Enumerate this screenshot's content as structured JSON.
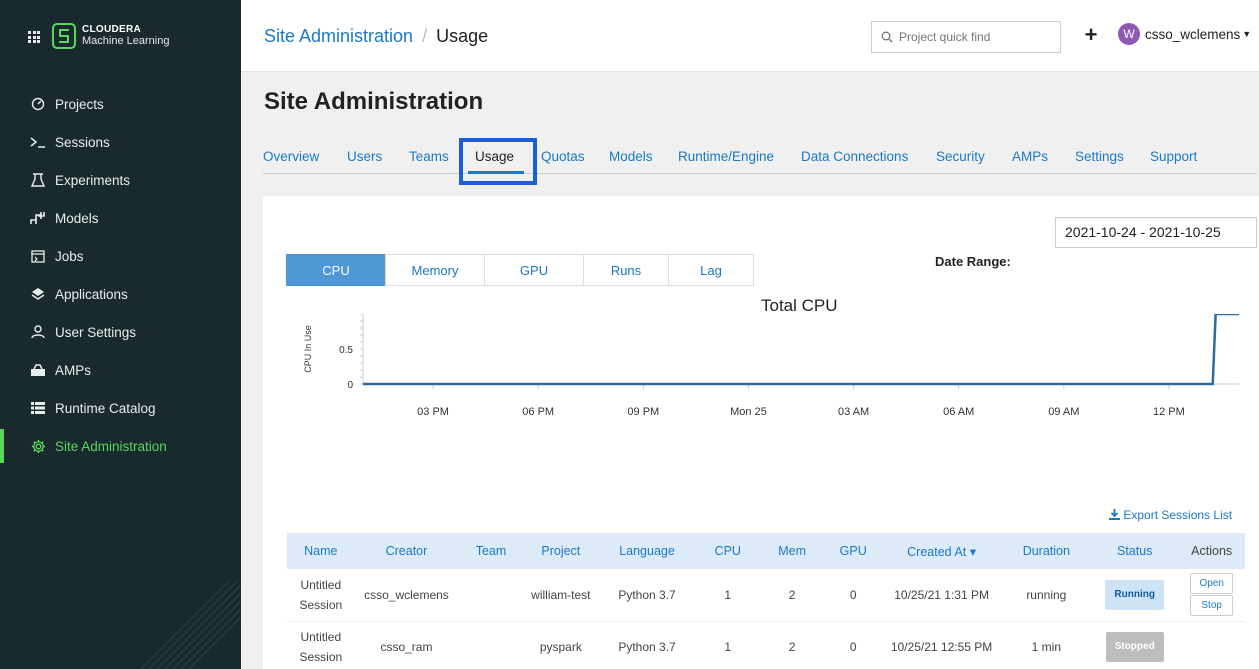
{
  "sidebar": {
    "brand": {
      "name": "CLOUDERA",
      "sub": "Machine Learning"
    },
    "items": [
      {
        "label": "Projects",
        "icon": "projects-icon"
      },
      {
        "label": "Sessions",
        "icon": "terminal-icon"
      },
      {
        "label": "Experiments",
        "icon": "flask-icon"
      },
      {
        "label": "Models",
        "icon": "models-icon"
      },
      {
        "label": "Jobs",
        "icon": "jobs-icon"
      },
      {
        "label": "Applications",
        "icon": "layers-icon"
      },
      {
        "label": "User Settings",
        "icon": "user-icon"
      },
      {
        "label": "AMPs",
        "icon": "briefcase-icon"
      },
      {
        "label": "Runtime Catalog",
        "icon": "list-icon"
      },
      {
        "label": "Site Administration",
        "icon": "gear-icon",
        "active": true
      }
    ]
  },
  "header": {
    "crumb_parent": "Site Administration",
    "crumb_sep": "/",
    "crumb_current": "Usage",
    "search_placeholder": "Project quick find",
    "plus": "+",
    "avatar_letter": "W",
    "username": "csso_wclemens"
  },
  "page": {
    "title": "Site Administration",
    "tabs": [
      "Overview",
      "Users",
      "Teams",
      "Usage",
      "Quotas",
      "Models",
      "Runtime/Engine",
      "Data Connections",
      "Security",
      "AMPs",
      "Settings",
      "Support"
    ],
    "active_tab": "Usage"
  },
  "usage": {
    "metric_tabs": [
      "CPU",
      "Memory",
      "GPU",
      "Runs",
      "Lag"
    ],
    "active_metric": "CPU",
    "date_range_label": "Date Range:",
    "date_range_value": "2021-10-24 - 2021-10-25",
    "export_label": "Export Sessions List"
  },
  "chart_data": {
    "type": "line",
    "title": "Total CPU",
    "ylabel": "CPU In Use",
    "xlabel": "",
    "x_tick_labels": [
      "03 PM",
      "06 PM",
      "09 PM",
      "Mon 25",
      "03 AM",
      "06 AM",
      "09 AM",
      "12 PM"
    ],
    "y_tick_labels": [
      "0",
      "0.5"
    ],
    "ylim": [
      0,
      1
    ],
    "color": "#2c6d9e",
    "series": [
      {
        "x": [
          "2021-10-24 13:00",
          "2021-10-25 13:15",
          "2021-10-25 13:20",
          "2021-10-25 14:00"
        ],
        "y": [
          0,
          0,
          1,
          1
        ]
      }
    ]
  },
  "table": {
    "columns": [
      "Name",
      "Creator",
      "Team",
      "Project",
      "Language",
      "CPU",
      "Mem",
      "GPU",
      "Created At",
      "Duration",
      "Status",
      "Actions"
    ],
    "sort_indicator": "▾",
    "rows": [
      {
        "name": "Untitled Session",
        "creator": "csso_wclemens",
        "team": "",
        "project": "william-test",
        "language": "Python 3.7",
        "cpu": "1",
        "mem": "2",
        "gpu": "0",
        "created": "10/25/21 1:31 PM",
        "duration": "running",
        "status": "Running",
        "actions": [
          "Open",
          "Stop"
        ]
      },
      {
        "name": "Untitled Session",
        "creator": "csso_ram",
        "team": "",
        "project": "pyspark",
        "language": "Python 3.7",
        "cpu": "1",
        "mem": "2",
        "gpu": "0",
        "created": "10/25/21 12:55 PM",
        "duration": "1 min",
        "status": "Stopped",
        "actions": []
      }
    ]
  }
}
